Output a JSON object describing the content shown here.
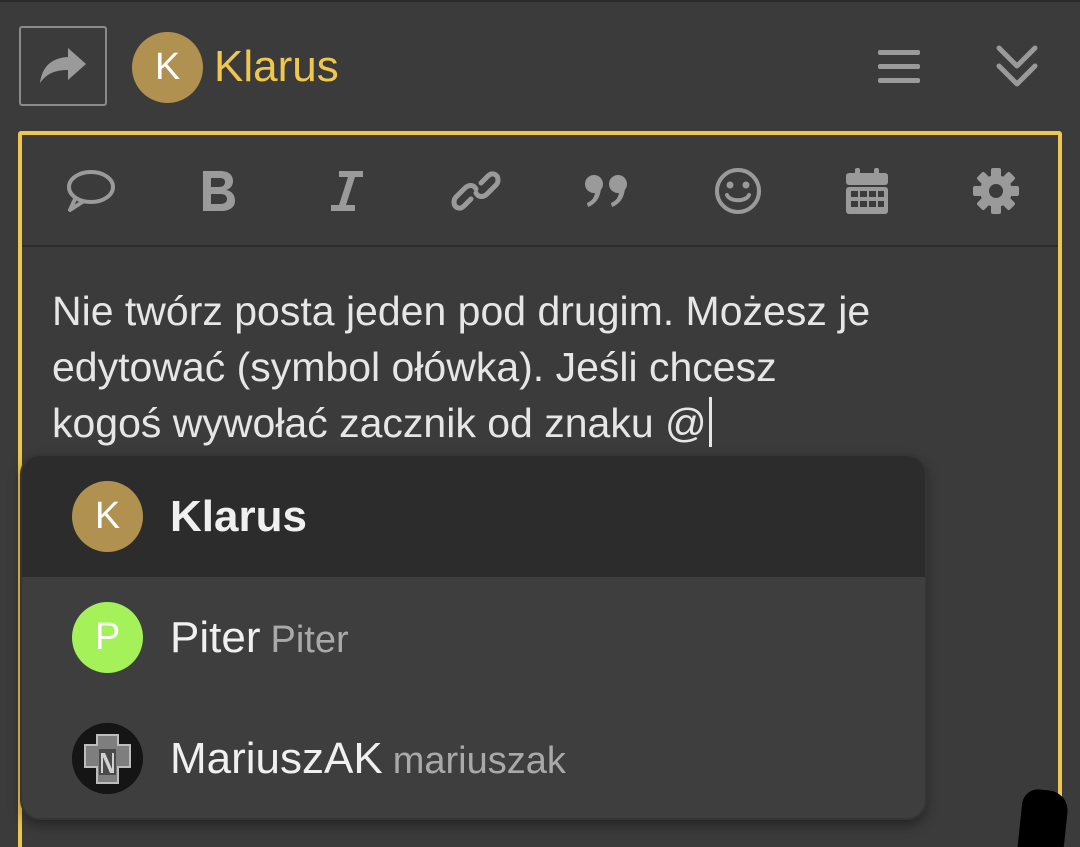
{
  "colors": {
    "accent": "#f0c64e",
    "background": "#3b3b3b",
    "icon": "#9a9a9a",
    "avatar_klarus": "#b0914f",
    "avatar_piter": "#a4f15a"
  },
  "header": {
    "reply_icon": "reply-arrow-icon",
    "avatar_letter": "K",
    "username": "Klarus",
    "menu_icon": "hamburger-menu-icon",
    "collapse_icon": "double-chevron-down-icon"
  },
  "toolbar": {
    "buttons": [
      {
        "name": "speech-bubble-icon"
      },
      {
        "name": "bold-icon"
      },
      {
        "name": "italic-icon"
      },
      {
        "name": "link-icon"
      },
      {
        "name": "quote-icon"
      },
      {
        "name": "emoji-icon"
      },
      {
        "name": "calendar-icon"
      },
      {
        "name": "gear-icon"
      }
    ]
  },
  "editor": {
    "lines": [
      "Nie twórz posta jeden pod drugim. Możesz je",
      "edytować (symbol ołówka). Jeśli chcesz",
      "kogoś wywołać zacznik od znaku @"
    ]
  },
  "mentions": [
    {
      "avatar_letter": "K",
      "name": "Klarus",
      "handle": "",
      "selected": true
    },
    {
      "avatar_letter": "P",
      "name": "Piter",
      "handle": "Piter",
      "selected": false
    },
    {
      "avatar_letter": "",
      "name": "MariuszAK",
      "handle": "mariuszak",
      "selected": false
    }
  ]
}
